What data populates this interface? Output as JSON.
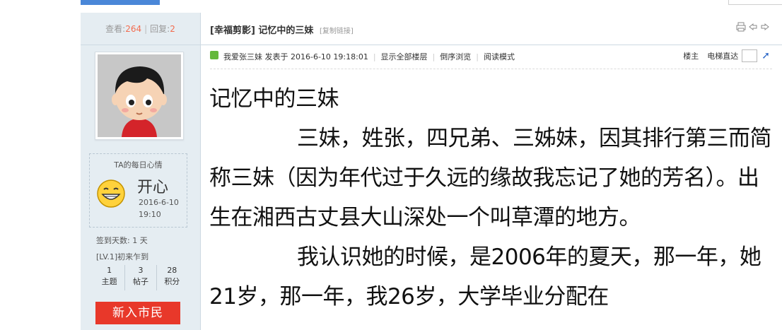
{
  "left": {
    "views_label": "查看:",
    "views": "264",
    "replies_label": "回复:",
    "replies": "2",
    "mood_title": "TA的每日心情",
    "mood": "开心",
    "mood_date": "2016-6-10",
    "mood_time": "19:10",
    "checkin": "签到天数: 1 天",
    "level": "[LV.1]初来乍到",
    "counts": [
      {
        "value": "1",
        "label": "主题"
      },
      {
        "value": "3",
        "label": "帖子"
      },
      {
        "value": "28",
        "label": "积分"
      }
    ],
    "badge": "新入市民"
  },
  "thread": {
    "category": "[幸福剪影]",
    "title": "记忆中的三妹",
    "copy_link": "[复制链接]"
  },
  "meta": {
    "author": "我爱张三妹",
    "posted": "发表于 2016-6-10 19:18:01",
    "show_all": "显示全部楼层",
    "reverse": "倒序浏览",
    "read_mode": "阅读模式",
    "floor": "楼主",
    "jump": "电梯直达"
  },
  "post": {
    "title": "记忆中的三妹",
    "para1": "三妹，姓张，四兄弟、三姊妹，因其排行第三而简称三妹（因为年代过于久远的缘故我忘记了她的芳名）。出生在湘西古丈县大山深处一个叫草潭的地方。",
    "para2": "我认识她的时候，是2006年的夏天，那一年，她21岁，那一年，我26岁，大学毕业分配在"
  }
}
